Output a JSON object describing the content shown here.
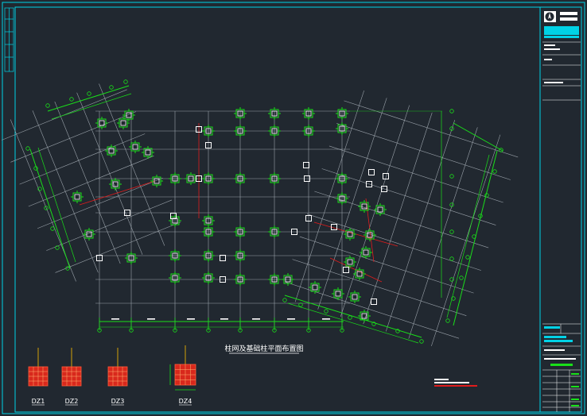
{
  "drawing": {
    "title": "柱网及基础柱平面布置图",
    "column_labels": [
      "DZ1",
      "DZ2",
      "DZ3",
      "DZ4"
    ]
  },
  "colors": {
    "background": "#212830",
    "frame": "#00d2e6",
    "grid": "#9aa2aa",
    "axis": "#19e019",
    "column": "#ffffff",
    "section_fill": "#d8281c",
    "section_rebar": "#ffc000",
    "red_line": "#e01c1c"
  },
  "icons": [
    "north-arrow-icon"
  ]
}
